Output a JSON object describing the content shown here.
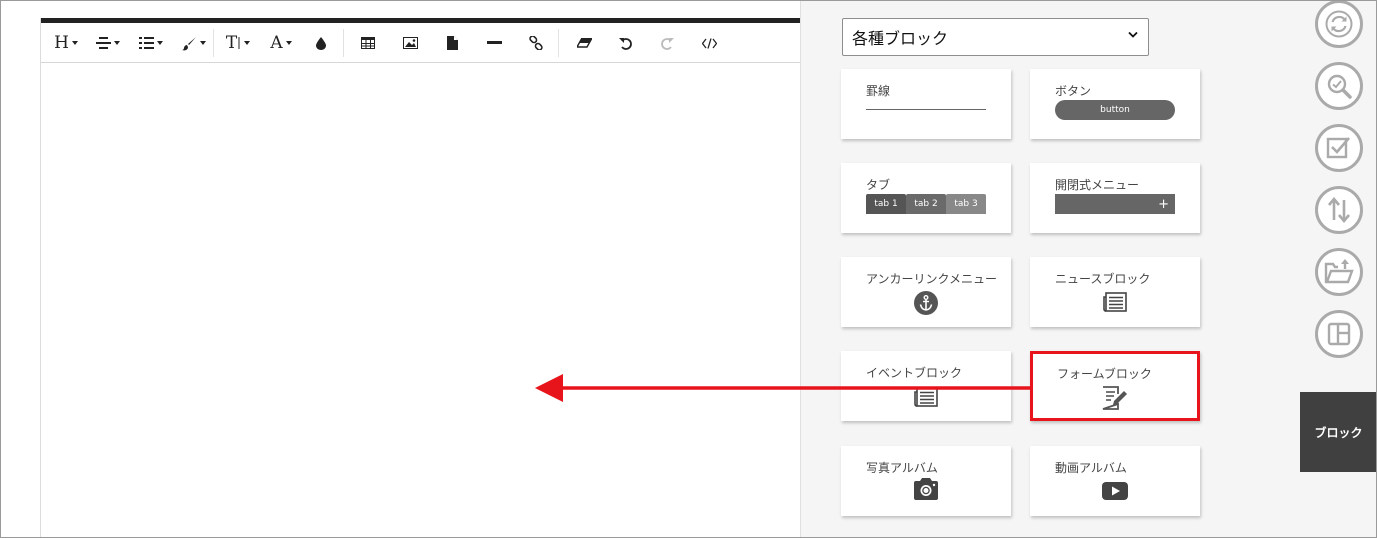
{
  "toolbar": {
    "heading_label": "H",
    "text_size_label": "T",
    "font_label": "A",
    "buttons": [
      "heading",
      "align",
      "list",
      "brush",
      "text-size",
      "font",
      "color",
      "table",
      "image",
      "file",
      "horizontal-rule",
      "link",
      "eraser",
      "undo",
      "redo",
      "source-code"
    ]
  },
  "panel": {
    "select_value": "各種ブロック",
    "cards": {
      "rule": {
        "title": "罫線"
      },
      "button": {
        "title": "ボタン",
        "preview_label": "button"
      },
      "tab": {
        "title": "タブ",
        "tabs": [
          "tab 1",
          "tab 2",
          "tab 3"
        ]
      },
      "accordion": {
        "title": "開閉式メニュー",
        "plus": "+"
      },
      "anchor": {
        "title": "アンカーリンクメニュー",
        "icon": "anchor-icon"
      },
      "news": {
        "title": "ニュースブロック",
        "icon": "news-icon"
      },
      "event": {
        "title": "イベントブロック",
        "icon": "news-icon"
      },
      "form": {
        "title": "フォームブロック",
        "icon": "form-edit-icon"
      },
      "photo": {
        "title": "写真アルバム",
        "icon": "camera-icon"
      },
      "video": {
        "title": "動画アルバム",
        "icon": "play-icon"
      }
    }
  },
  "rail": {
    "icons": [
      "refresh-icon",
      "search-icon",
      "checkbox-icon",
      "sort-icon",
      "folder-upload-icon",
      "layout-icon"
    ],
    "block_label": "ブロック"
  },
  "colors": {
    "highlight": "#e8141c",
    "dark": "#404040",
    "preview_gray": "#666666"
  }
}
